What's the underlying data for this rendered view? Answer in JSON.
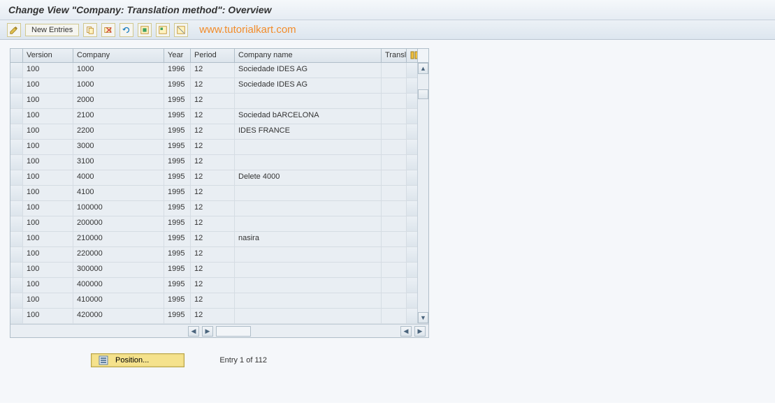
{
  "title": "Change View \"Company: Translation method\": Overview",
  "toolbar": {
    "new_entries_label": "New Entries"
  },
  "watermark_text": "www.tutorialkart.com",
  "table": {
    "headers": {
      "version": "Version",
      "company": "Company",
      "year": "Year",
      "period": "Period",
      "company_name": "Company name",
      "transla": "Transla"
    },
    "rows": [
      {
        "version": "100",
        "company": "1000",
        "year": "1996",
        "period": "12",
        "company_name": "Sociedade IDES AG"
      },
      {
        "version": "100",
        "company": "1000",
        "year": "1995",
        "period": "12",
        "company_name": "Sociedade IDES AG"
      },
      {
        "version": "100",
        "company": "2000",
        "year": "1995",
        "period": "12",
        "company_name": ""
      },
      {
        "version": "100",
        "company": "2100",
        "year": "1995",
        "period": "12",
        "company_name": "Sociedad bARCELONA"
      },
      {
        "version": "100",
        "company": "2200",
        "year": "1995",
        "period": "12",
        "company_name": "IDES FRANCE"
      },
      {
        "version": "100",
        "company": "3000",
        "year": "1995",
        "period": "12",
        "company_name": ""
      },
      {
        "version": "100",
        "company": "3100",
        "year": "1995",
        "period": "12",
        "company_name": ""
      },
      {
        "version": "100",
        "company": "4000",
        "year": "1995",
        "period": "12",
        "company_name": "Delete 4000"
      },
      {
        "version": "100",
        "company": "4100",
        "year": "1995",
        "period": "12",
        "company_name": ""
      },
      {
        "version": "100",
        "company": "100000",
        "year": "1995",
        "period": "12",
        "company_name": ""
      },
      {
        "version": "100",
        "company": "200000",
        "year": "1995",
        "period": "12",
        "company_name": ""
      },
      {
        "version": "100",
        "company": "210000",
        "year": "1995",
        "period": "12",
        "company_name": "nasira"
      },
      {
        "version": "100",
        "company": "220000",
        "year": "1995",
        "period": "12",
        "company_name": ""
      },
      {
        "version": "100",
        "company": "300000",
        "year": "1995",
        "period": "12",
        "company_name": ""
      },
      {
        "version": "100",
        "company": "400000",
        "year": "1995",
        "period": "12",
        "company_name": ""
      },
      {
        "version": "100",
        "company": "410000",
        "year": "1995",
        "period": "12",
        "company_name": ""
      },
      {
        "version": "100",
        "company": "420000",
        "year": "1995",
        "period": "12",
        "company_name": ""
      }
    ]
  },
  "footer": {
    "position_label": "Position...",
    "entry_status": "Entry 1 of 112"
  }
}
